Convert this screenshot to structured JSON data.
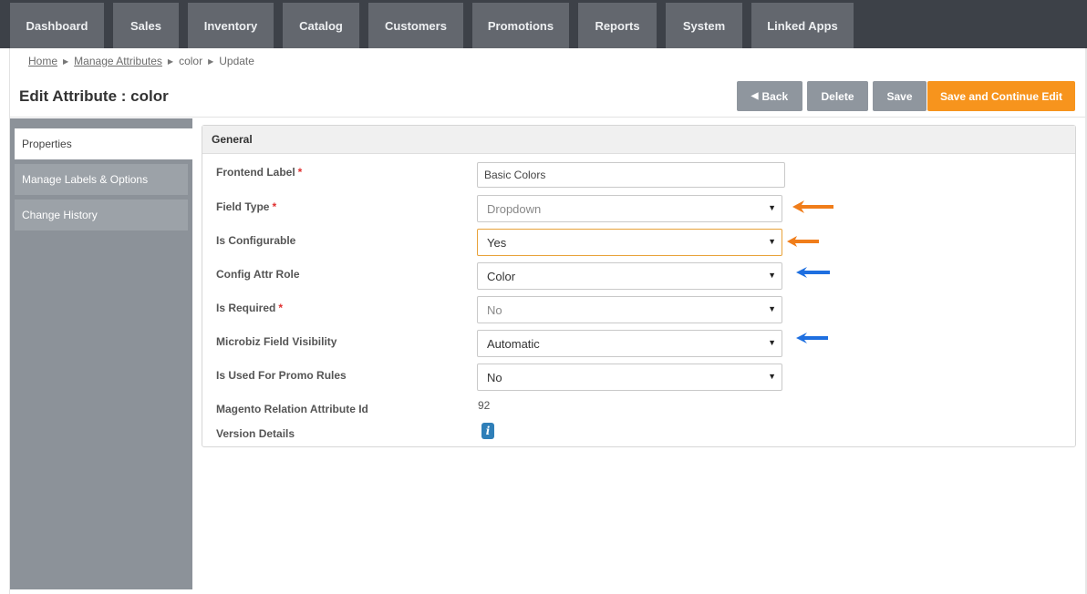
{
  "nav": {
    "tabs": [
      "Dashboard",
      "Sales",
      "Inventory",
      "Catalog",
      "Customers",
      "Promotions",
      "Reports",
      "System",
      "Linked Apps"
    ]
  },
  "breadcrumb": {
    "home": "Home",
    "manage_attributes": "Manage Attributes",
    "color": "color",
    "update": "Update"
  },
  "page": {
    "title": "Edit Attribute : color"
  },
  "actions": {
    "back": "Back",
    "delete": "Delete",
    "save": "Save",
    "save_continue": "Save and Continue Edit"
  },
  "sidebar": {
    "items": [
      "Properties",
      "Manage Labels & Options",
      "Change History"
    ]
  },
  "panel": {
    "title": "General"
  },
  "fields": {
    "frontend_label": {
      "label": "Frontend Label",
      "required": "*",
      "value": "Basic Colors"
    },
    "field_type": {
      "label": "Field Type",
      "required": "*",
      "value": "Dropdown"
    },
    "is_configurable": {
      "label": "Is Configurable",
      "value": "Yes"
    },
    "config_attr_role": {
      "label": "Config Attr Role",
      "value": "Color"
    },
    "is_required": {
      "label": "Is Required",
      "required": "*",
      "value": "No"
    },
    "microbiz_visibility": {
      "label": "Microbiz Field Visibility",
      "value": "Automatic"
    },
    "promo_rules": {
      "label": "Is Used For Promo Rules",
      "value": "No"
    },
    "magento_relation": {
      "label": "Magento Relation Attribute Id",
      "value": "92"
    },
    "version_details": {
      "label": "Version Details"
    }
  },
  "icons": {
    "info": "i",
    "caret": "▼",
    "back_arrow": "◀"
  },
  "colors": {
    "nav_bg": "#3d4148",
    "tab_bg": "#63676e",
    "accent_orange": "#f7941d",
    "button_grey": "#8f969e",
    "sidebar_bg": "#8c9299",
    "annotation_orange": "#f07d1a",
    "annotation_blue": "#1e6fe0",
    "info_blue": "#2f7fb8"
  }
}
